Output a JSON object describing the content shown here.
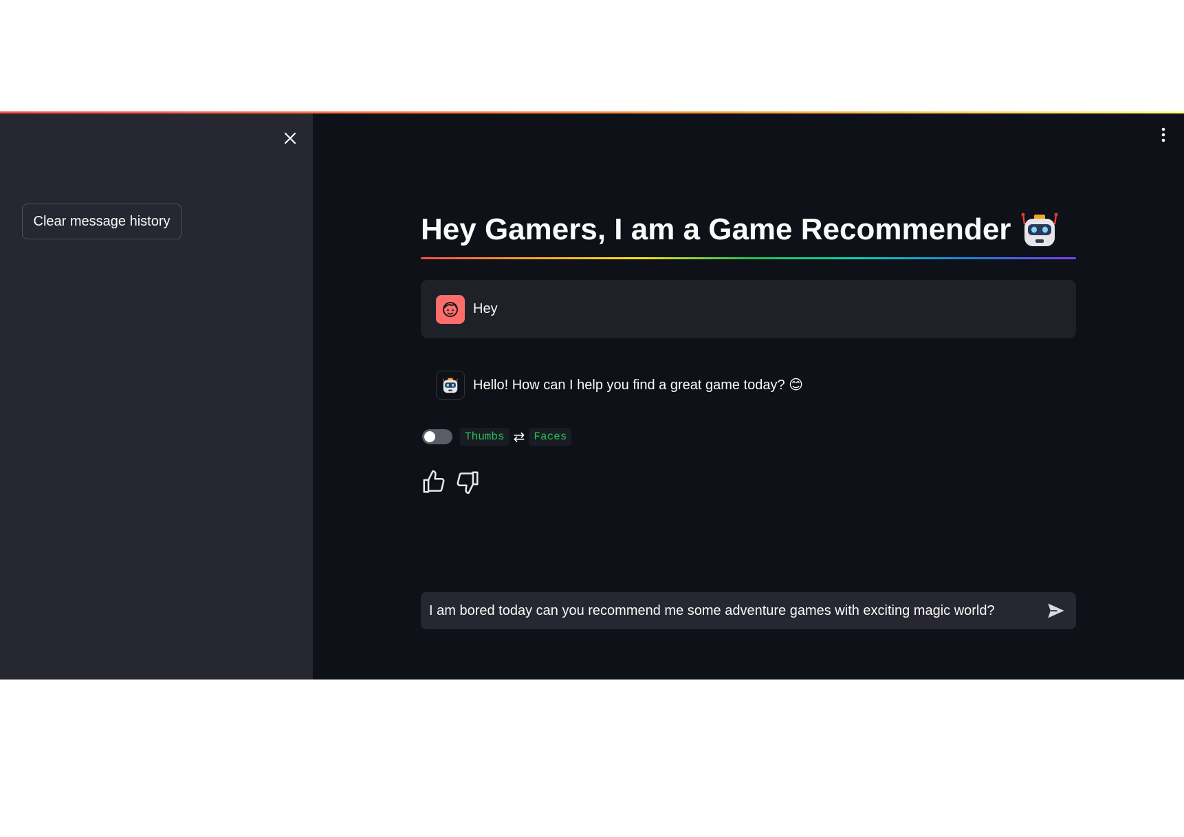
{
  "sidebar": {
    "clear_button_label": "Clear message history"
  },
  "header": {
    "title": "Hey Gamers, I am a Game Recommender"
  },
  "messages": [
    {
      "role": "user",
      "text": "Hey"
    },
    {
      "role": "assistant",
      "text": "Hello! How can I help you find a great game today? 😊"
    }
  ],
  "feedback": {
    "toggle_on": false,
    "option_a": "Thumbs",
    "separator": "⇄",
    "option_b": "Faces"
  },
  "chat_input": {
    "value": "I am bored today can you recommend me some adventure games with exciting magic world?"
  },
  "colors": {
    "background": "#0e1117",
    "sidebar": "#262730",
    "user_avatar": "#ff6c6c",
    "code_green": "#21c354"
  },
  "icons": {
    "close": "close-icon",
    "menu": "kebab-menu-icon",
    "title_emoji": "robot-icon",
    "user_avatar": "user-face-icon",
    "bot_avatar": "robot-icon",
    "thumbs_up": "thumbs-up-icon",
    "thumbs_down": "thumbs-down-icon",
    "send": "send-icon"
  }
}
